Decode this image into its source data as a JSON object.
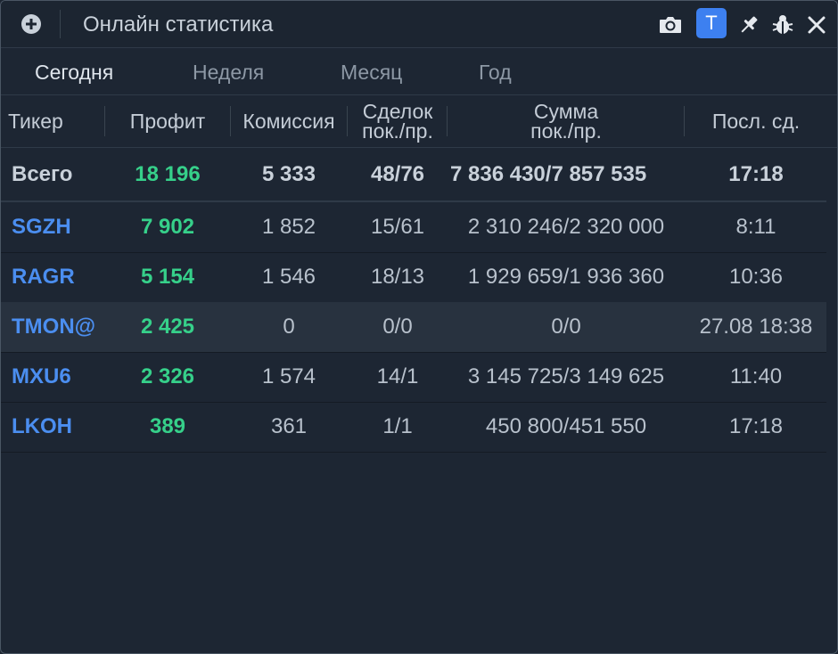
{
  "window": {
    "title": "Онлайн статистика"
  },
  "toolbar": {
    "badge_label": "T"
  },
  "tabs": [
    {
      "label": "Сегодня",
      "active": true
    },
    {
      "label": "Неделя",
      "active": false
    },
    {
      "label": "Месяц",
      "active": false
    },
    {
      "label": "Год",
      "active": false
    }
  ],
  "table": {
    "columns": [
      {
        "line1": "Тикер",
        "line2": ""
      },
      {
        "line1": "Профит",
        "line2": ""
      },
      {
        "line1": "Комиссия",
        "line2": ""
      },
      {
        "line1": "Сделок",
        "line2": "пок./пр."
      },
      {
        "line1": "Сумма",
        "line2": "пок./пр."
      },
      {
        "line1": "Посл. сд.",
        "line2": ""
      }
    ],
    "total": {
      "ticker": "Всего",
      "profit": "18 196",
      "commission": "5 333",
      "trades": "48/76",
      "sum": "7 836 430/7 857 535",
      "last": "17:18"
    },
    "rows": [
      {
        "ticker": "SGZH",
        "profit": "7 902",
        "commission": "1 852",
        "trades": "15/61",
        "sum": "2 310 246/2 320 000",
        "last": "8:11"
      },
      {
        "ticker": "RAGR",
        "profit": "5 154",
        "commission": "1 546",
        "trades": "18/13",
        "sum": "1 929 659/1 936 360",
        "last": "10:36"
      },
      {
        "ticker": "TMON@",
        "profit": "2 425",
        "commission": "0",
        "trades": "0/0",
        "sum": "0/0",
        "last": "27.08 18:38"
      },
      {
        "ticker": "MXU6",
        "profit": "2 326",
        "commission": "1 574",
        "trades": "14/1",
        "sum": "3 145 725/3 149 625",
        "last": "11:40"
      },
      {
        "ticker": "LKOH",
        "profit": "389",
        "commission": "361",
        "trades": "1/1",
        "sum": "450 800/451 550",
        "last": "17:18"
      }
    ]
  },
  "colors": {
    "background": "#1d2633",
    "accent": "#3d80f0",
    "ticker": "#4b8ef0",
    "profit": "#36d08a"
  },
  "icons": [
    "plus-circle-icon",
    "camera-icon",
    "pin-icon",
    "bug-icon",
    "close-icon"
  ]
}
